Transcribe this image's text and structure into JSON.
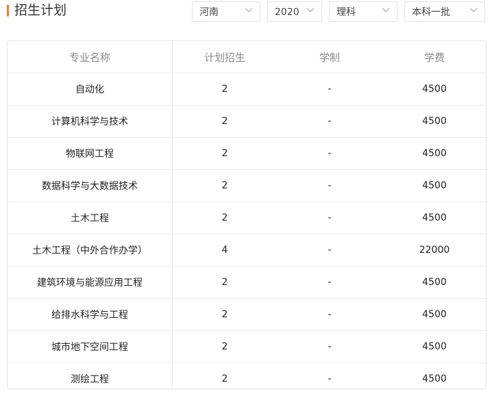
{
  "header": {
    "title": "招生计划"
  },
  "filters": {
    "province": "河南",
    "year": "2020",
    "subject": "理科",
    "batch": "本科一批"
  },
  "table": {
    "columns": [
      "专业名称",
      "计划招生",
      "学制",
      "学费"
    ],
    "rows": [
      [
        "自动化",
        "2",
        "-",
        "4500"
      ],
      [
        "计算机科学与技术",
        "2",
        "-",
        "4500"
      ],
      [
        "物联网工程",
        "2",
        "-",
        "4500"
      ],
      [
        "数据科学与大数据技术",
        "2",
        "-",
        "4500"
      ],
      [
        "土木工程",
        "2",
        "-",
        "4500"
      ],
      [
        "土木工程（中外合作办学）",
        "4",
        "-",
        "22000"
      ],
      [
        "建筑环境与能源应用工程",
        "2",
        "-",
        "4500"
      ],
      [
        "给排水科学与工程",
        "2",
        "-",
        "4500"
      ],
      [
        "城市地下空间工程",
        "2",
        "-",
        "4500"
      ],
      [
        "测绘工程",
        "2",
        "-",
        "4500"
      ]
    ]
  },
  "colors": {
    "accent": "#f07b2a",
    "border": "#e6e6e6"
  }
}
